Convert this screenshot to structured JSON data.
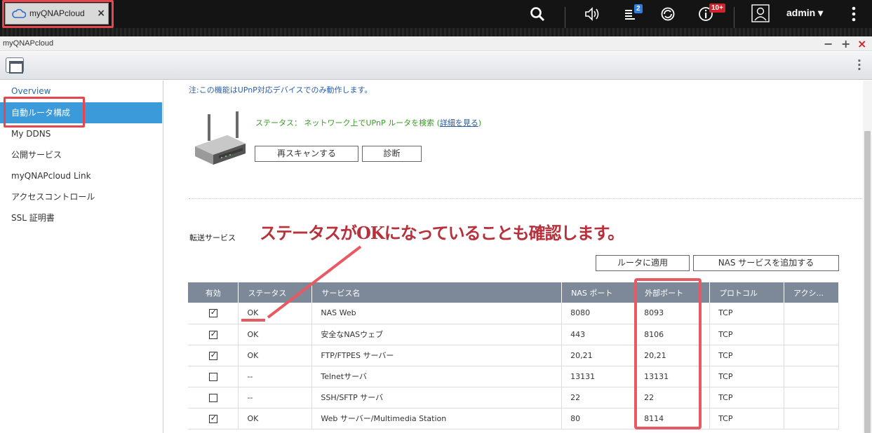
{
  "topbar": {
    "tab_label": "myQNAPcloud",
    "tab_close": "×",
    "notifications_badge": "2",
    "events_badge": "10+",
    "user": "admin ▾",
    "accent": "#e8464f"
  },
  "window": {
    "title": "myQNAPcloud",
    "minimize": "−",
    "maximize": "+",
    "close": "×"
  },
  "sidebar": {
    "items": [
      {
        "label": "Overview"
      },
      {
        "label": "自動ルータ構成"
      },
      {
        "label": "My DDNS"
      },
      {
        "label": "公開サービス"
      },
      {
        "label": "myQNAPcloud Link"
      },
      {
        "label": "アクセスコントロール"
      },
      {
        "label": "SSL 証明書"
      }
    ],
    "active_color": "#3b9ad9"
  },
  "main": {
    "note": "注:この機能はUPnP対応デバイスでのみ動作します。",
    "status_prefix": "ステータス：",
    "status_text": "ネットワーク上でUPnP ルータを検索",
    "detail_link": "詳細を見る",
    "rescan_button": "再スキャンする",
    "diagnose_button": "診断",
    "section_label": "転送サービス",
    "annotation": "ステータスがOKになっていることも確認します。",
    "apply_button": "ルータに適用",
    "add_service_button": "NAS サービスを追加する",
    "table": {
      "headers": [
        "有効",
        "ステータス",
        "サービス名",
        "NAS ポート",
        "外部ポート",
        "プロトコル",
        "アクシ..."
      ],
      "rows": [
        {
          "enabled": true,
          "status": "OK",
          "service": "NAS Web",
          "nas_port": "8080",
          "ext_port": "8093",
          "protocol": "TCP"
        },
        {
          "enabled": true,
          "status": "OK",
          "service": "安全なNASウェブ",
          "nas_port": "443",
          "ext_port": "8106",
          "protocol": "TCP"
        },
        {
          "enabled": true,
          "status": "OK",
          "service": "FTP/FTPES サーバー",
          "nas_port": "20,21",
          "ext_port": "20,21",
          "protocol": "TCP"
        },
        {
          "enabled": false,
          "status": "--",
          "service": "Telnetサーバ",
          "nas_port": "13131",
          "ext_port": "13131",
          "protocol": "TCP"
        },
        {
          "enabled": false,
          "status": "--",
          "service": "SSH/SFTP サーバ",
          "nas_port": "22",
          "ext_port": "22",
          "protocol": "TCP"
        },
        {
          "enabled": true,
          "status": "OK",
          "service": "Web サーバー/Multimedia Station",
          "nas_port": "80",
          "ext_port": "8114",
          "protocol": "TCP"
        }
      ]
    }
  }
}
